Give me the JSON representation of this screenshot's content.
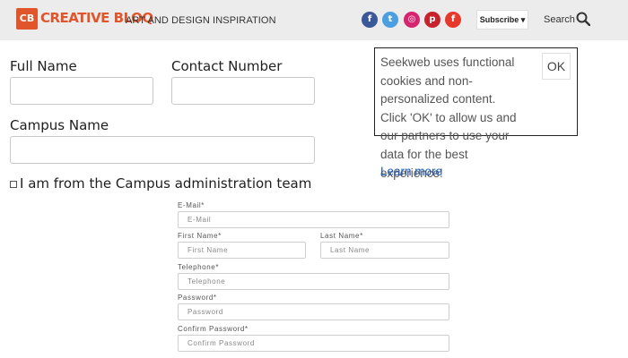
{
  "header": {
    "logo_badge": "CB",
    "logo_text": "CREATIVE BLOQ",
    "tagline": "ART AND DESIGN INSPIRATION",
    "social": [
      {
        "icon": "facebook-icon",
        "glyph": "f",
        "color": "#3b5998"
      },
      {
        "icon": "twitter-icon",
        "glyph": "t",
        "color": "#4b9fe0"
      },
      {
        "icon": "instagram-icon",
        "glyph": "◎",
        "color": "#d6246e"
      },
      {
        "icon": "pinterest-icon",
        "glyph": "p",
        "color": "#c8232c"
      },
      {
        "icon": "flipboard-icon",
        "glyph": "f",
        "color": "#e6392b"
      }
    ],
    "subscribe_label": "Subscribe ▾",
    "search_label": "Search",
    "accent_color": "#e0552a"
  },
  "form_top": {
    "full_name_label": "Full Name",
    "contact_number_label": "Contact Number",
    "campus_name_label": "Campus Name",
    "checkbox_label": "I am from the Campus administration team"
  },
  "form_bottom": {
    "email_label": "E-Mail*",
    "email_placeholder": "E-Mail",
    "first_name_label": "First Name*",
    "first_name_placeholder": "First Name",
    "last_name_label": "Last Name*",
    "last_name_placeholder": "Last Name",
    "telephone_label": "Telephone*",
    "telephone_placeholder": "Telephone",
    "password_label": "Password*",
    "password_placeholder": "Password",
    "confirm_password_label": "Confirm Password*",
    "confirm_password_placeholder": "Confirm Password"
  },
  "cookie": {
    "text": "Seekweb uses functional cookies and non-personalized content. Click 'OK' to allow us and our partners to use your data for the best experience!",
    "link_label": "Learn more",
    "ok_label": "OK"
  }
}
